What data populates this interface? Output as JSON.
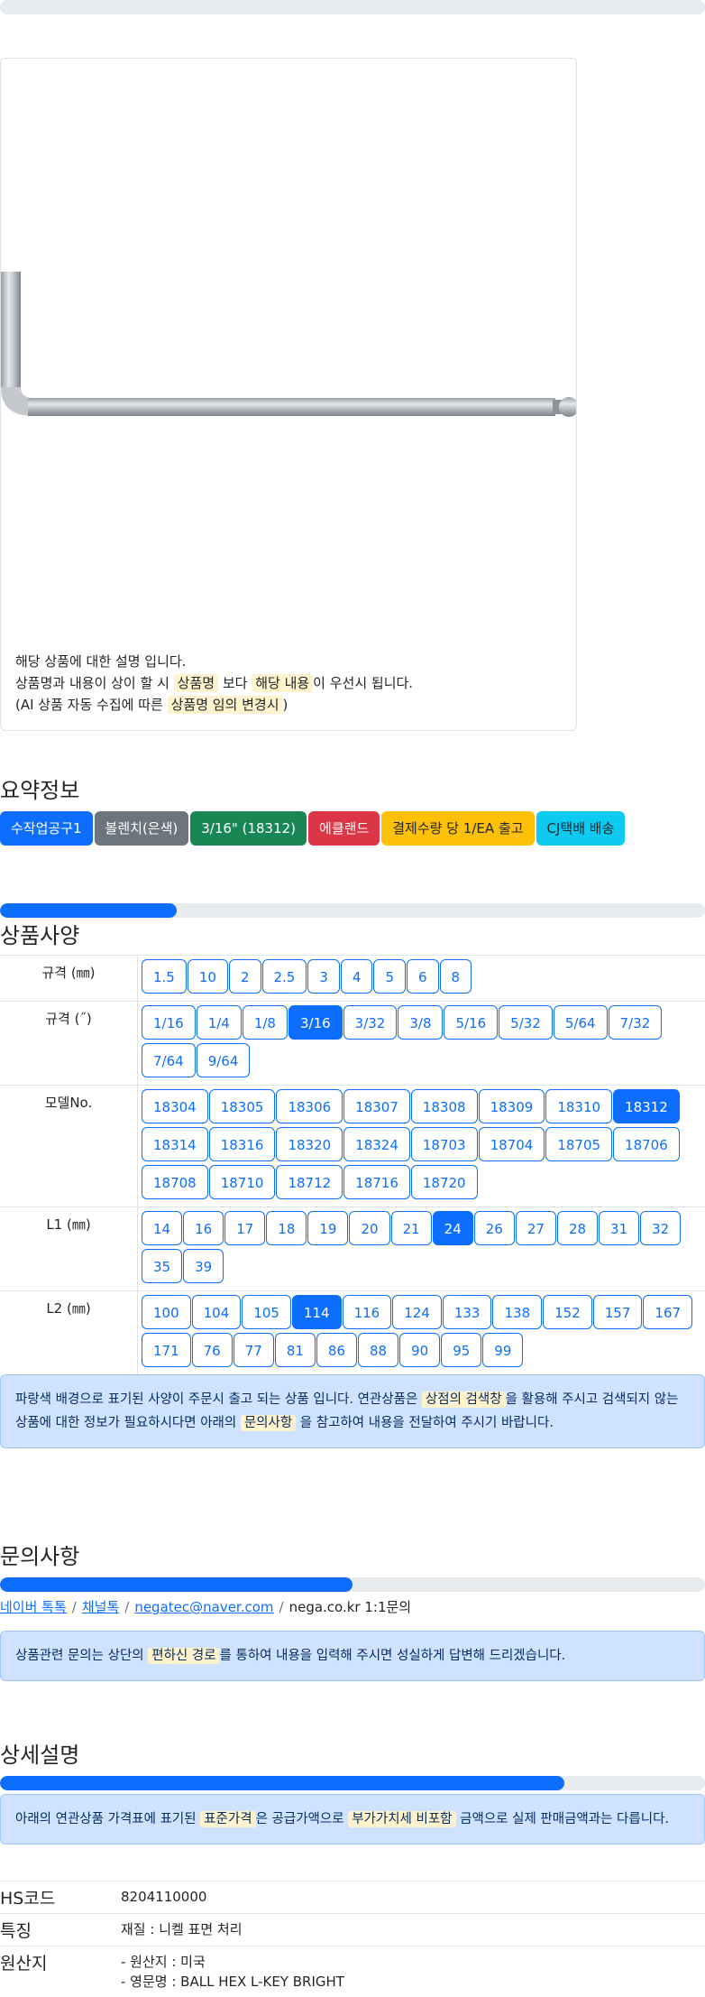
{
  "note": {
    "line1": "해당 상품에 대한 설명 입니다.",
    "line2_a": "상품명과 내용이 상이 할 시 ",
    "line2_h1": "상품명",
    "line2_b": " 보다 ",
    "line2_h2": "해당 내용",
    "line2_c": "이 우선시 됩니다.",
    "line3_a": "(AI 상품 자동 수집에 따른 ",
    "line3_h": "상품명 임의 변경시",
    "line3_b": ")"
  },
  "summary": {
    "title": "요약정보",
    "badges": [
      {
        "label": "수작업공구1",
        "color": "#0d6efd"
      },
      {
        "label": "볼렌치(은색)",
        "color": "#6c757d"
      },
      {
        "label": "3/16\" (18312)",
        "color": "#198754"
      },
      {
        "label": "에클랜드",
        "color": "#dc3545"
      },
      {
        "label": "결제수량 당 1/EA 출고",
        "color": "#ffc107"
      },
      {
        "label": "CJ택배 배송",
        "color": "#0dcaf0"
      }
    ]
  },
  "spec": {
    "title": "상품사양",
    "progress": 0.25,
    "rows": [
      {
        "label": "규격 (㎜)",
        "options": [
          "1.5",
          "10",
          "2",
          "2.5",
          "3",
          "4",
          "5",
          "6",
          "8"
        ],
        "selected": null
      },
      {
        "label": "규격 (˝)",
        "options": [
          "1/16",
          "1/4",
          "1/8",
          "3/16",
          "3/32",
          "3/8",
          "5/16",
          "5/32",
          "5/64",
          "7/32",
          "7/64",
          "9/64"
        ],
        "selected": "3/16"
      },
      {
        "label": "모델No.",
        "options": [
          "18304",
          "18305",
          "18306",
          "18307",
          "18308",
          "18309",
          "18310",
          "18312",
          "18314",
          "18316",
          "18320",
          "18324",
          "18703",
          "18704",
          "18705",
          "18706",
          "18708",
          "18710",
          "18712",
          "18716",
          "18720"
        ],
        "selected": "18312"
      },
      {
        "label": "L1 (㎜)",
        "options": [
          "14",
          "16",
          "17",
          "18",
          "19",
          "20",
          "21",
          "24",
          "26",
          "27",
          "28",
          "31",
          "32",
          "35",
          "39"
        ],
        "selected": "24"
      },
      {
        "label": "L2 (㎜)",
        "options": [
          "100",
          "104",
          "105",
          "114",
          "116",
          "124",
          "133",
          "138",
          "152",
          "157",
          "167",
          "171",
          "76",
          "77",
          "81",
          "86",
          "88",
          "90",
          "95",
          "99"
        ],
        "selected": "114"
      }
    ],
    "info_a": "파랑색 배경으로 표기된 사양이 주문시 출고 되는 상품 입니다. 연관상품은 ",
    "info_h1": "상점의 검색창",
    "info_b": "을 활용해 주시고 검색되지 않는 상품에 대한 정보가 필요하시다면 아래의 ",
    "info_h2": "문의사항",
    "info_c": " 을 참고하여 내용을 전달하여 주시기 바랍니다."
  },
  "inquiry": {
    "title": "문의사항",
    "progress": 0.5,
    "links": [
      "네이버 톡톡",
      "채널톡",
      "negatec@naver.com"
    ],
    "plain": "nega.co.kr 1:1문의",
    "info_a": "상품관련 문의는 상단의 ",
    "info_h": "편하신 경로",
    "info_b": "를 통하여 내용을 입력해 주시면 성실하게 답변해 드리겠습니다."
  },
  "detail": {
    "title": "상세설명",
    "progress": 0.8,
    "info_a": "아래의 연관상품 가격표에 표기된 ",
    "info_h1": "표준가격",
    "info_b": "은 공급가액으로 ",
    "info_h2": "부가가치세 비포함",
    "info_c": " 금액으로 실제 판매금액과는 다릅니다.",
    "rows": [
      {
        "k": "HS코드",
        "v1": "8204110000",
        "v2": ""
      },
      {
        "k": "특징",
        "v1": "재질 : 니켈 표면 처리",
        "v2": ""
      },
      {
        "k": "원산지",
        "v1": "- 원산지 : 미국",
        "v2": "- 영문명 : BALL HEX L-KEY BRIGHT"
      }
    ]
  }
}
